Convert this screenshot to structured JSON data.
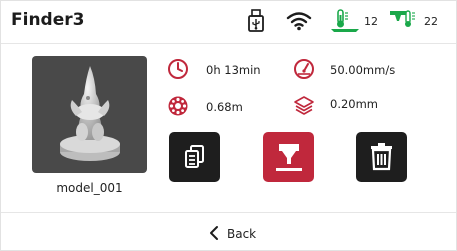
{
  "header": {
    "title": "Finder3",
    "bed_temp": "12",
    "nozzle_temp": "22"
  },
  "file": {
    "name": "model_001",
    "print_time": "0h 13min",
    "speed": "50.00mm/s",
    "filament_length": "0.68m",
    "layer_height": "0.20mm"
  },
  "footer": {
    "back_label": "Back"
  },
  "colors": {
    "accent_red": "#c0283c",
    "button_dark": "#1e1e1e",
    "temp_green": "#1aa84a"
  },
  "icons": {
    "usb": "usb-icon",
    "wifi": "wifi-icon",
    "bed_temp": "bed-temperature-icon",
    "nozzle_temp": "nozzle-temperature-icon",
    "clock": "clock-icon",
    "speed": "speedometer-icon",
    "filament": "filament-spool-icon",
    "layers": "layers-icon",
    "files": "files-icon",
    "print": "print-icon",
    "delete": "trash-icon",
    "back": "chevron-left-icon"
  }
}
